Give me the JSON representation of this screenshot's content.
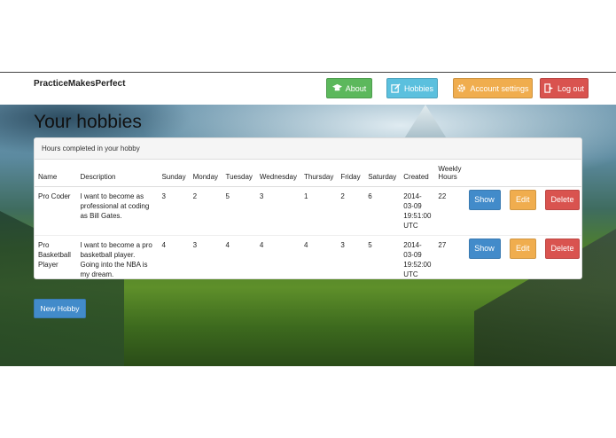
{
  "navbar": {
    "brand": "PracticeMakesPerfect",
    "about_label": "About",
    "hobbies_label": "Hobbies",
    "account_label": "Account settings",
    "logout_label": "Log out"
  },
  "page": {
    "title": "Your hobbies",
    "panel_heading": "Hours completed in your hobby",
    "new_button": "New Hobby"
  },
  "table": {
    "headers": [
      "Name",
      "Description",
      "Sunday",
      "Monday",
      "Tuesday",
      "Wednesday",
      "Thursday",
      "Friday",
      "Saturday",
      "Created",
      "Weekly Hours"
    ],
    "rows": [
      {
        "name": "Pro Coder",
        "description": "I want to become as professional at coding as Bill Gates.",
        "sunday": "3",
        "monday": "2",
        "tuesday": "5",
        "wednesday": "3",
        "thursday": "1",
        "friday": "2",
        "saturday": "6",
        "created": "2014-03-09 19:51:00 UTC",
        "weekly": "22"
      },
      {
        "name": "Pro Basketball Player",
        "description": "I want to become a pro basketball player. Going into the NBA is my dream.",
        "sunday": "4",
        "monday": "3",
        "tuesday": "4",
        "wednesday": "4",
        "thursday": "4",
        "friday": "3",
        "saturday": "5",
        "created": "2014-03-09 19:52:00 UTC",
        "weekly": "27"
      }
    ],
    "show_label": "Show",
    "edit_label": "Edit",
    "delete_label": "Delete"
  },
  "colors": {
    "about": "#5cb85c",
    "hobbies": "#5bc0de",
    "account": "#f0ad4e",
    "logout": "#d9534f",
    "primary": "#428bca"
  }
}
